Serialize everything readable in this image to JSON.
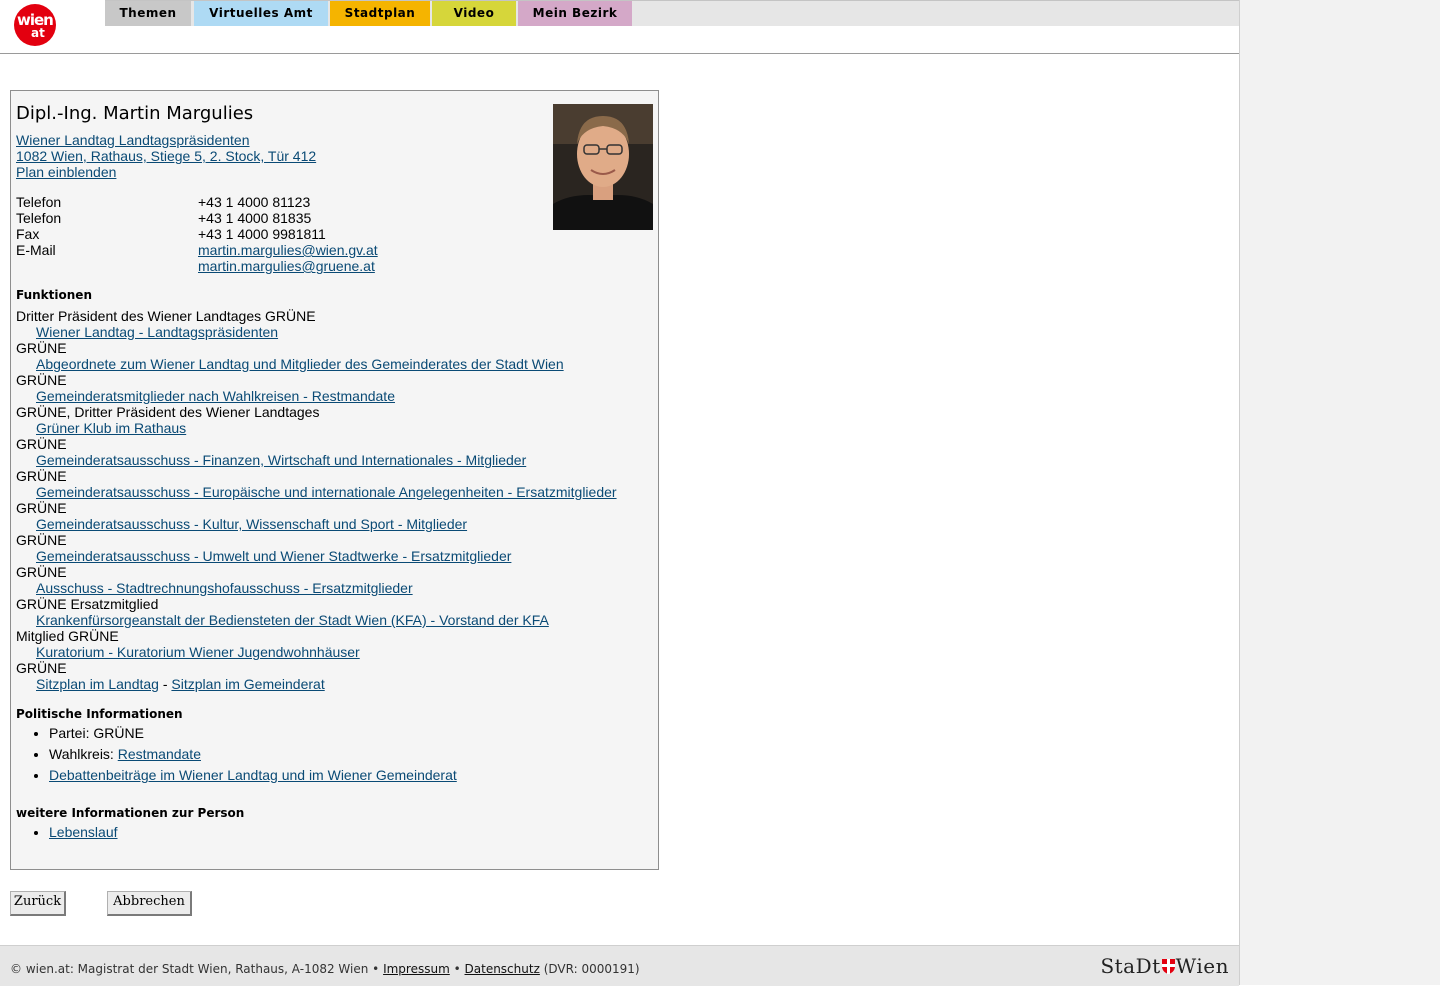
{
  "logo": {
    "line1": "wien",
    "line2": "at"
  },
  "nav": {
    "tabs": [
      "Themen",
      "Virtuelles Amt",
      "Stadtplan",
      "Video",
      "Mein Bezirk"
    ]
  },
  "person": {
    "name": "Dipl.-Ing. Martin Margulies",
    "org_link": "Wiener Landtag Landtagspräsidenten",
    "address_link": "1082 Wien, Rathaus, Stiege 5, 2. Stock, Tür 412",
    "plan_link": "Plan einblenden"
  },
  "contacts": [
    {
      "label": "Telefon",
      "value": "+43 1 4000 81123"
    },
    {
      "label": "Telefon",
      "value": "+43 1 4000 81835"
    },
    {
      "label": "Fax",
      "value": "+43 1 4000 9981811"
    },
    {
      "label": "E-Mail",
      "value": "martin.margulies@wien.gv.at"
    },
    {
      "label": "",
      "value": "martin.margulies@gruene.at"
    }
  ],
  "functions_heading": "Funktionen",
  "functions": [
    {
      "role": "Dritter Präsident des Wiener Landtages GRÜNE",
      "link": "Wiener Landtag - Landtagspräsidenten"
    },
    {
      "role": "GRÜNE",
      "link": "Abgeordnete zum Wiener Landtag und Mitglieder des Gemeinderates der Stadt Wien"
    },
    {
      "role": "GRÜNE",
      "link": "Gemeinderatsmitglieder nach Wahlkreisen - Restmandate"
    },
    {
      "role": "GRÜNE, Dritter Präsident des Wiener Landtages",
      "link": "Grüner Klub im Rathaus"
    },
    {
      "role": "GRÜNE",
      "link": "Gemeinderatsausschuss - Finanzen, Wirtschaft und Internationales - Mitglieder"
    },
    {
      "role": "GRÜNE",
      "link": "Gemeinderatsausschuss - Europäische und internationale Angelegenheiten - Ersatzmitglieder"
    },
    {
      "role": "GRÜNE",
      "link": "Gemeinderatsausschuss - Kultur, Wissenschaft und Sport - Mitglieder"
    },
    {
      "role": "GRÜNE",
      "link": "Gemeinderatsausschuss - Umwelt und Wiener Stadtwerke - Ersatzmitglieder"
    },
    {
      "role": "GRÜNE",
      "link": "Ausschuss - Stadtrechnungshofausschuss - Ersatzmitglieder"
    },
    {
      "role": "GRÜNE Ersatzmitglied",
      "link": "Krankenfürsorgeanstalt der Bediensteten der Stadt Wien (KFA) - Vorstand der KFA"
    },
    {
      "role": "Mitglied GRÜNE",
      "link": "Kuratorium - Kuratorium Wiener Jugendwohnhäuser"
    },
    {
      "role": "GRÜNE",
      "link": ""
    }
  ],
  "sitzplan": {
    "landtag": "Sitzplan im Landtag",
    "separator": " - ",
    "gemeinderat": "Sitzplan im Gemeinderat"
  },
  "political": {
    "heading": "Politische Informationen",
    "party_label": "Partei:",
    "party": "GRÜNE",
    "wahlkreis_label": "Wahlkreis:",
    "wahlkreis": "Restmandate",
    "debates": "Debattenbeiträge im Wiener Landtag und im Wiener Gemeinderat"
  },
  "more": {
    "heading": "weitere Informationen zur Person",
    "cv": "Lebenslauf"
  },
  "buttons": {
    "back": "Zurück",
    "cancel": "Abbrechen"
  },
  "footer": {
    "text": "© wien.at: Magistrat der Stadt Wien, Rathaus, A-1082 Wien •",
    "impressum": "Impressum",
    "bullet": "•",
    "datenschutz": "Datenschutz",
    "dvr": "(DVR: 0000191)",
    "brand_left": "StaDt",
    "brand_right": "Wien"
  },
  "colors": {
    "link": "#0a4a75",
    "tab_themen": "#c8c8c8",
    "tab_amt": "#aedaf4",
    "tab_plan": "#f5b400",
    "tab_video": "#d6d63a",
    "tab_bezirk": "#d4a8c8",
    "logo_red": "#e3000f"
  }
}
